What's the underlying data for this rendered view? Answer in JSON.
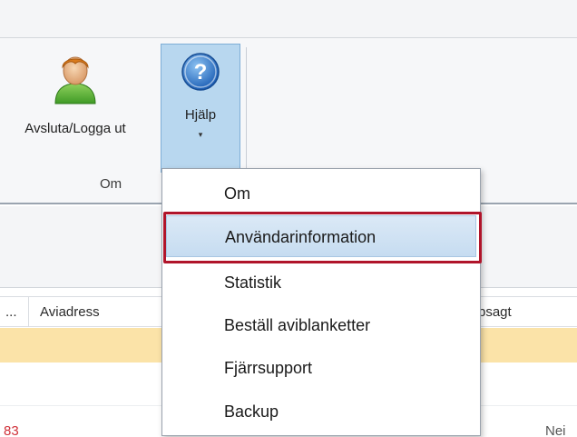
{
  "ribbon": {
    "logout_label": "Avsluta/Logga ut",
    "help_label": "Hjälp",
    "help_caret": "▾",
    "group_label": "Om"
  },
  "grid": {
    "columns": [
      "...",
      "Aviadress",
      "psagt"
    ],
    "partial_row": {
      "num": "83",
      "value": "Nei"
    }
  },
  "help_menu": {
    "items": [
      {
        "label": "Om",
        "highlighted": false
      },
      {
        "label": "Användarinformation",
        "highlighted": true
      },
      {
        "label": "Statistik",
        "highlighted": false
      },
      {
        "label": "Beställ aviblanketter",
        "highlighted": false
      },
      {
        "label": "Fjärrsupport",
        "highlighted": false
      },
      {
        "label": "Backup",
        "highlighted": false
      }
    ]
  },
  "icons": {
    "logout": "user-avatar-icon",
    "help": "question-mark-icon"
  },
  "colors": {
    "highlight_border": "#b0142a",
    "selected_row": "#fbe3a8",
    "help_button_active": "#b8d7ef"
  }
}
